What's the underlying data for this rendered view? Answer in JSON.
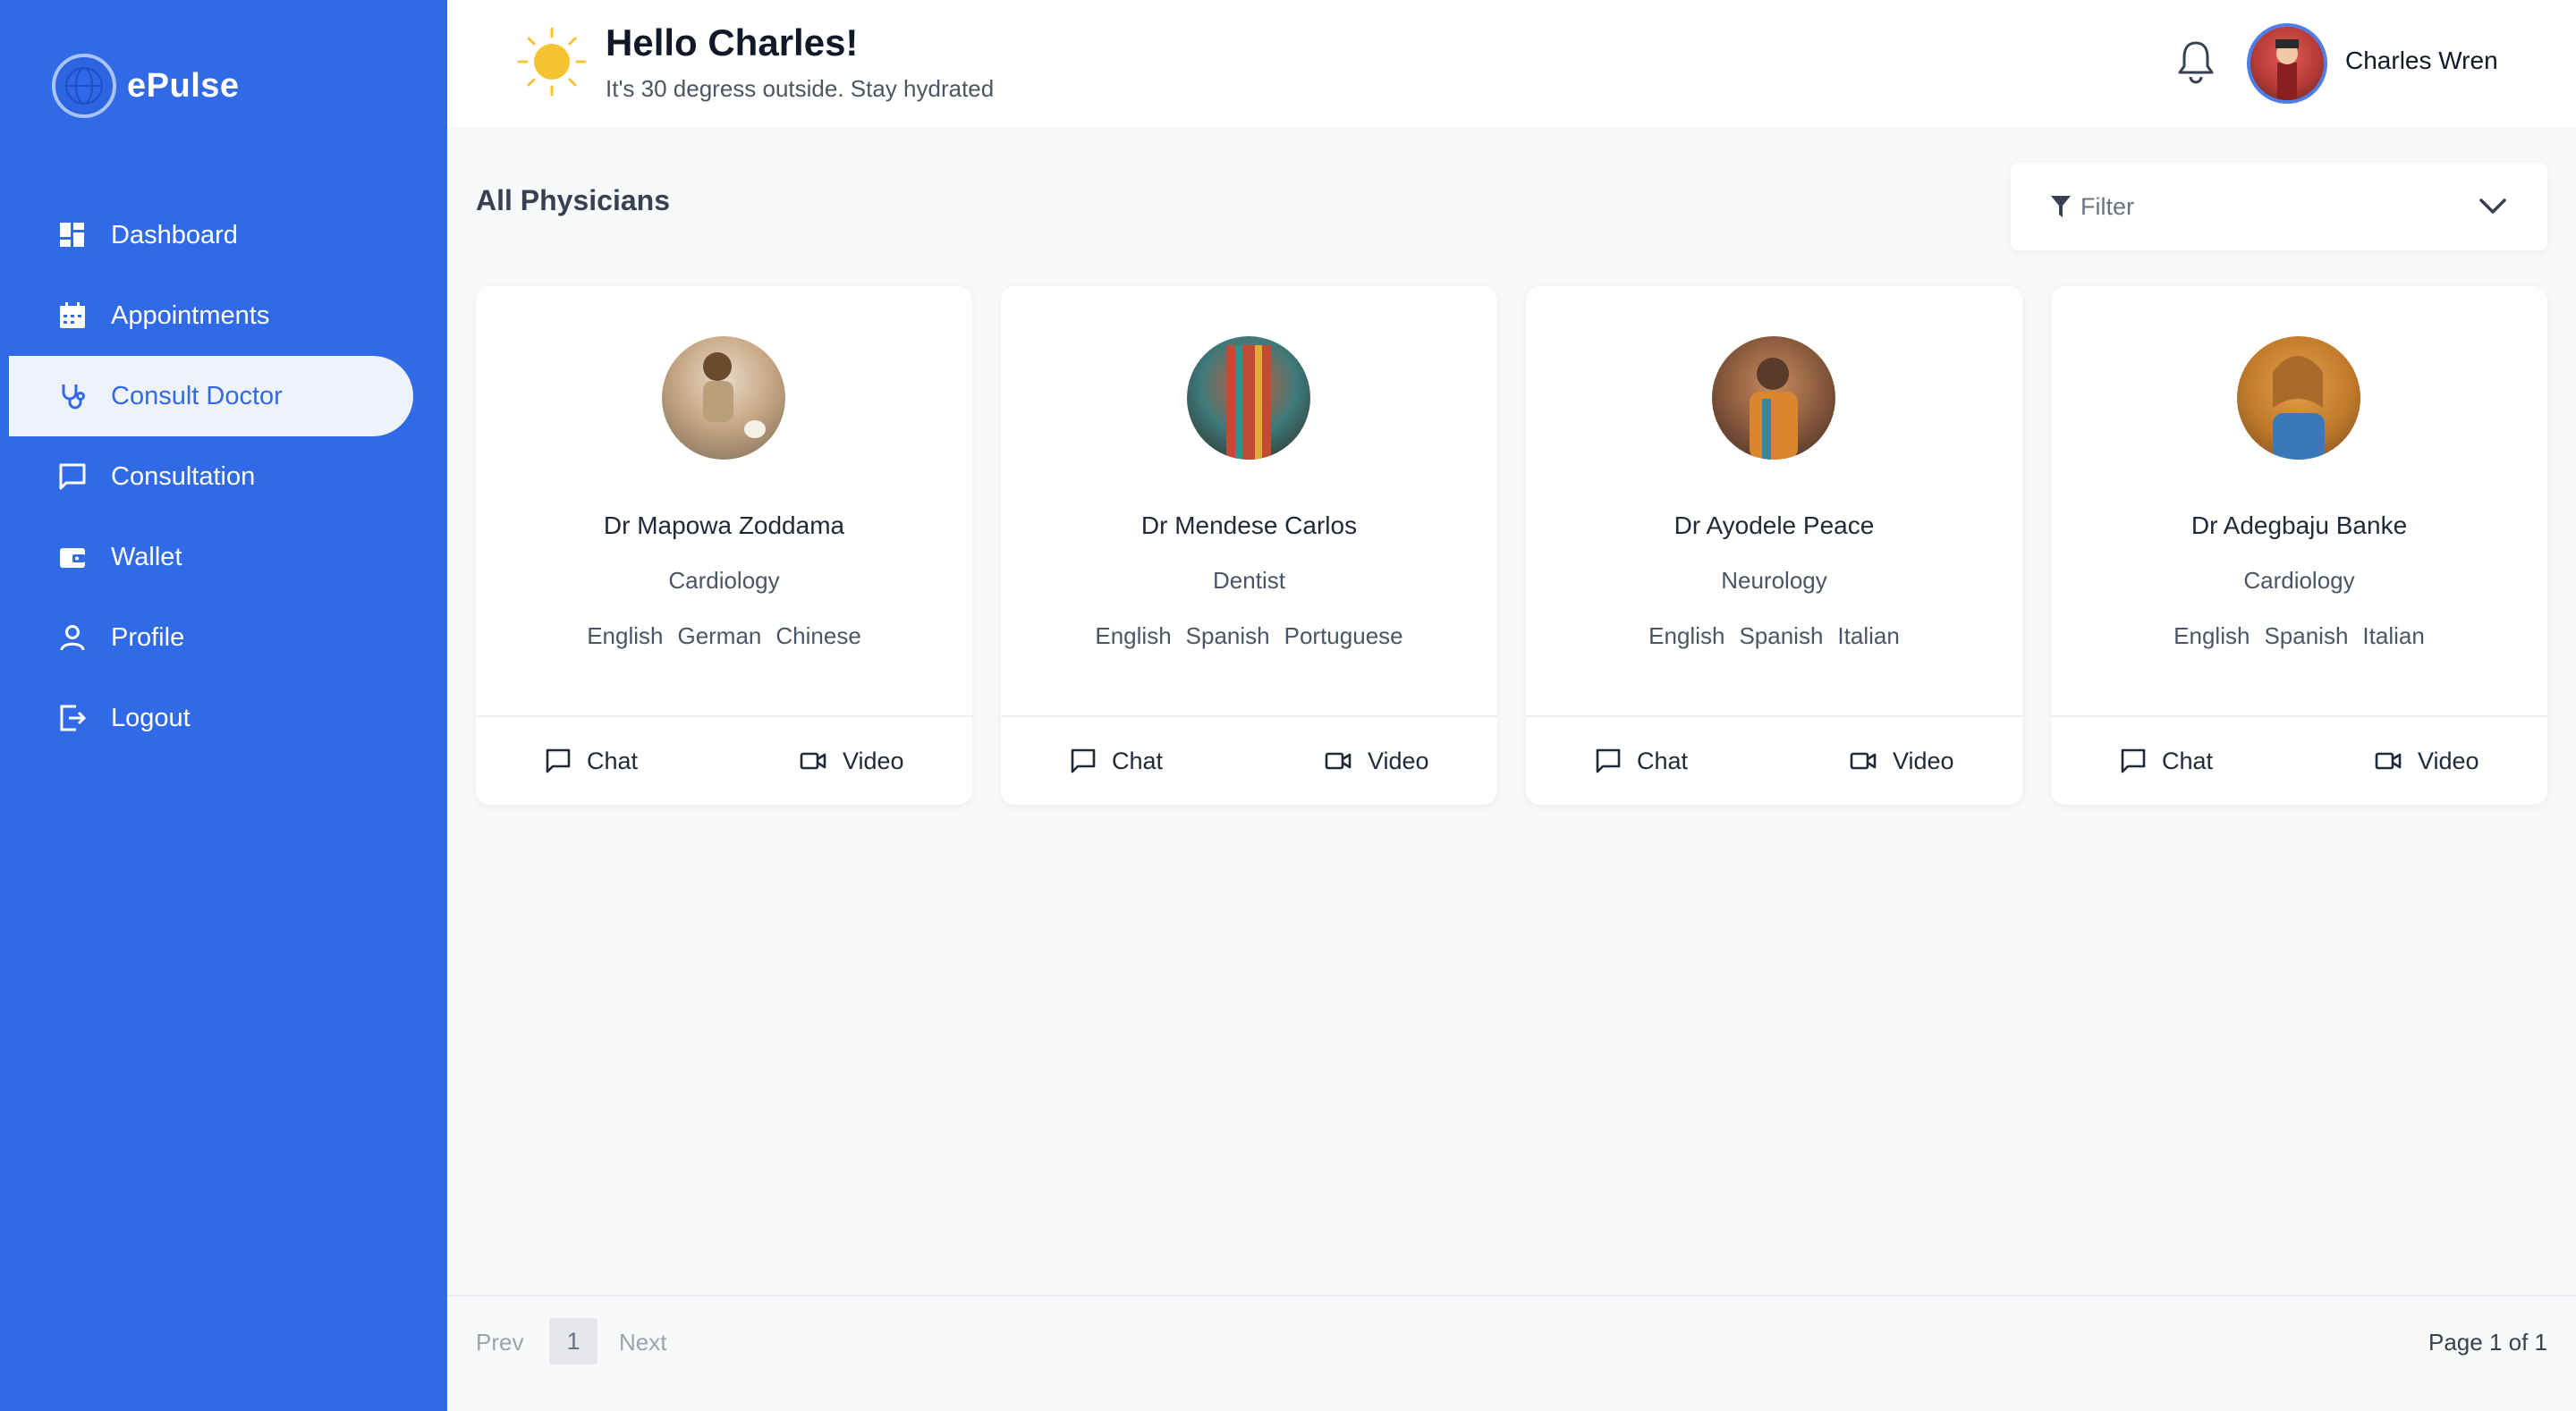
{
  "app": {
    "name": "ePulse"
  },
  "sidebar": {
    "items": [
      {
        "label": "Dashboard",
        "icon": "dashboard-icon",
        "active": false
      },
      {
        "label": "Appointments",
        "icon": "calendar-icon",
        "active": false
      },
      {
        "label": "Consult Doctor",
        "icon": "stethoscope-icon",
        "active": true
      },
      {
        "label": "Consultation",
        "icon": "chat-icon",
        "active": false
      },
      {
        "label": "Wallet",
        "icon": "wallet-icon",
        "active": false
      },
      {
        "label": "Profile",
        "icon": "user-icon",
        "active": false
      },
      {
        "label": "Logout",
        "icon": "logout-icon",
        "active": false
      }
    ]
  },
  "header": {
    "greeting": "Hello Charles!",
    "subtitle": "It's 30 degress outside. Stay hydrated",
    "user_name": "Charles Wren"
  },
  "main": {
    "title": "All Physicians",
    "filter_placeholder": "Filter",
    "physicians": [
      {
        "name": "Dr Mapowa Zoddama",
        "specialty": "Cardiology",
        "languages": [
          "English",
          "German",
          "Chinese"
        ],
        "chat_label": "Chat",
        "video_label": "Video"
      },
      {
        "name": "Dr Mendese Carlos",
        "specialty": "Dentist",
        "languages": [
          "English",
          "Spanish",
          "Portuguese"
        ],
        "chat_label": "Chat",
        "video_label": "Video"
      },
      {
        "name": "Dr Ayodele Peace",
        "specialty": "Neurology",
        "languages": [
          "English",
          "Spanish",
          "Italian"
        ],
        "chat_label": "Chat",
        "video_label": "Video"
      },
      {
        "name": "Dr Adegbaju Banke",
        "specialty": "Cardiology",
        "languages": [
          "English",
          "Spanish",
          "Italian"
        ],
        "chat_label": "Chat",
        "video_label": "Video"
      }
    ]
  },
  "pagination": {
    "prev_label": "Prev",
    "current_page": "1",
    "next_label": "Next",
    "page_status": "Page 1 of 1"
  },
  "colors": {
    "sidebar_bg": "#316ae6",
    "accent": "#316ae6",
    "page_bg": "#f8f9fb"
  }
}
